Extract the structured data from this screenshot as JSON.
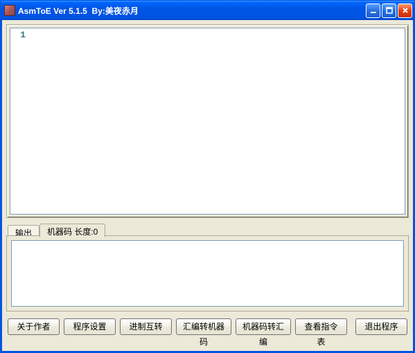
{
  "window": {
    "title": "AsmToE Ver 5.1.5  By:美夜赤月"
  },
  "editor": {
    "line_number": "1",
    "content": ""
  },
  "tabs": {
    "output_label": "输出",
    "machinecode_label": "机器码 长度:0"
  },
  "output": {
    "content": ""
  },
  "buttons": {
    "about": "关于作者",
    "settings": "程序设置",
    "radix": "进制互转",
    "asm_to_mc": "汇编转机器码",
    "mc_to_asm": "机器码转汇编",
    "opcode_table": "查看指令表",
    "exit": "退出程序"
  }
}
